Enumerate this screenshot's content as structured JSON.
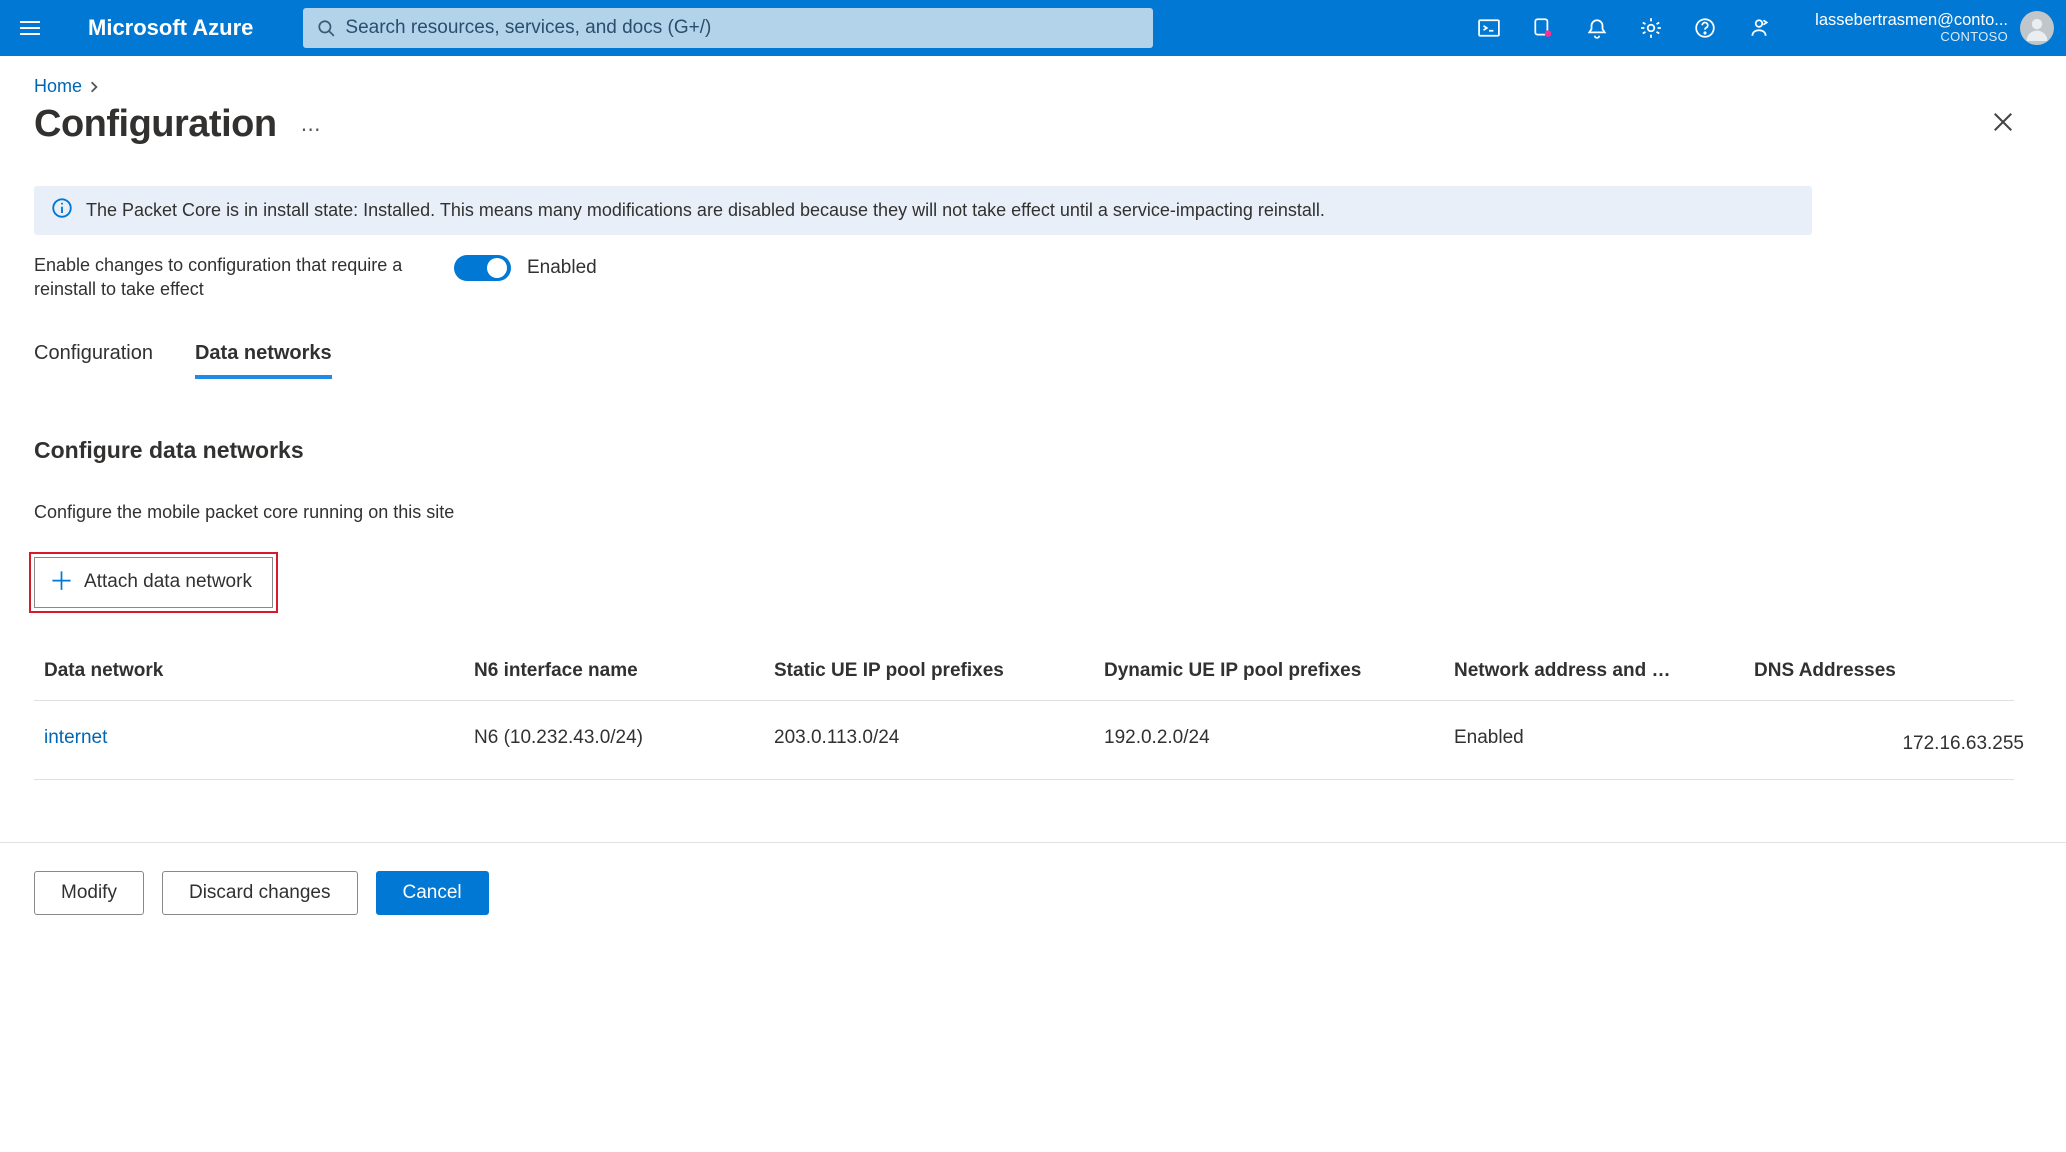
{
  "brand": "Microsoft Azure",
  "search": {
    "placeholder": "Search resources, services, and docs (G+/)"
  },
  "account": {
    "email": "lassebertrasmen@conto...",
    "org": "CONTOSO"
  },
  "breadcrumb": {
    "home": "Home"
  },
  "page": {
    "title": "Configuration"
  },
  "info": {
    "text": "The Packet Core is in install state: Installed. This means many modifications are disabled because they will not take effect until a service-impacting reinstall."
  },
  "enable": {
    "label": "Enable changes to configuration that require a reinstall to take effect",
    "state": "Enabled"
  },
  "tabs": {
    "configuration": "Configuration",
    "data_networks": "Data networks"
  },
  "section": {
    "title": "Configure data networks",
    "desc": "Configure the mobile packet core running on this site"
  },
  "attach": {
    "label": "Attach data network"
  },
  "table": {
    "headers": {
      "data_network": "Data network",
      "n6": "N6 interface name",
      "static_pool": "Static UE IP pool prefixes",
      "dynamic_pool": "Dynamic UE IP pool prefixes",
      "network_addr": "Network address and …",
      "dns": "DNS Addresses"
    },
    "rows": [
      {
        "data_network": "internet",
        "n6": "N6 (10.232.43.0/24)",
        "static_pool": "203.0.113.0/24",
        "dynamic_pool": "192.0.2.0/24",
        "network_addr": "Enabled",
        "dns": "172.16.63.255"
      }
    ]
  },
  "actions": {
    "modify": "Modify",
    "discard": "Discard changes",
    "cancel": "Cancel"
  }
}
